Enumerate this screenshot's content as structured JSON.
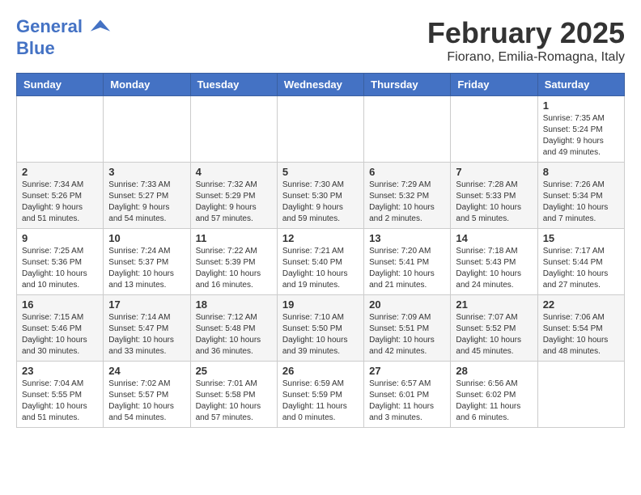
{
  "logo": {
    "line1": "General",
    "line2": "Blue"
  },
  "title": "February 2025",
  "location": "Fiorano, Emilia-Romagna, Italy",
  "weekdays": [
    "Sunday",
    "Monday",
    "Tuesday",
    "Wednesday",
    "Thursday",
    "Friday",
    "Saturday"
  ],
  "weeks": [
    [
      {
        "day": "",
        "info": ""
      },
      {
        "day": "",
        "info": ""
      },
      {
        "day": "",
        "info": ""
      },
      {
        "day": "",
        "info": ""
      },
      {
        "day": "",
        "info": ""
      },
      {
        "day": "",
        "info": ""
      },
      {
        "day": "1",
        "info": "Sunrise: 7:35 AM\nSunset: 5:24 PM\nDaylight: 9 hours\nand 49 minutes."
      }
    ],
    [
      {
        "day": "2",
        "info": "Sunrise: 7:34 AM\nSunset: 5:26 PM\nDaylight: 9 hours\nand 51 minutes."
      },
      {
        "day": "3",
        "info": "Sunrise: 7:33 AM\nSunset: 5:27 PM\nDaylight: 9 hours\nand 54 minutes."
      },
      {
        "day": "4",
        "info": "Sunrise: 7:32 AM\nSunset: 5:29 PM\nDaylight: 9 hours\nand 57 minutes."
      },
      {
        "day": "5",
        "info": "Sunrise: 7:30 AM\nSunset: 5:30 PM\nDaylight: 9 hours\nand 59 minutes."
      },
      {
        "day": "6",
        "info": "Sunrise: 7:29 AM\nSunset: 5:32 PM\nDaylight: 10 hours\nand 2 minutes."
      },
      {
        "day": "7",
        "info": "Sunrise: 7:28 AM\nSunset: 5:33 PM\nDaylight: 10 hours\nand 5 minutes."
      },
      {
        "day": "8",
        "info": "Sunrise: 7:26 AM\nSunset: 5:34 PM\nDaylight: 10 hours\nand 7 minutes."
      }
    ],
    [
      {
        "day": "9",
        "info": "Sunrise: 7:25 AM\nSunset: 5:36 PM\nDaylight: 10 hours\nand 10 minutes."
      },
      {
        "day": "10",
        "info": "Sunrise: 7:24 AM\nSunset: 5:37 PM\nDaylight: 10 hours\nand 13 minutes."
      },
      {
        "day": "11",
        "info": "Sunrise: 7:22 AM\nSunset: 5:39 PM\nDaylight: 10 hours\nand 16 minutes."
      },
      {
        "day": "12",
        "info": "Sunrise: 7:21 AM\nSunset: 5:40 PM\nDaylight: 10 hours\nand 19 minutes."
      },
      {
        "day": "13",
        "info": "Sunrise: 7:20 AM\nSunset: 5:41 PM\nDaylight: 10 hours\nand 21 minutes."
      },
      {
        "day": "14",
        "info": "Sunrise: 7:18 AM\nSunset: 5:43 PM\nDaylight: 10 hours\nand 24 minutes."
      },
      {
        "day": "15",
        "info": "Sunrise: 7:17 AM\nSunset: 5:44 PM\nDaylight: 10 hours\nand 27 minutes."
      }
    ],
    [
      {
        "day": "16",
        "info": "Sunrise: 7:15 AM\nSunset: 5:46 PM\nDaylight: 10 hours\nand 30 minutes."
      },
      {
        "day": "17",
        "info": "Sunrise: 7:14 AM\nSunset: 5:47 PM\nDaylight: 10 hours\nand 33 minutes."
      },
      {
        "day": "18",
        "info": "Sunrise: 7:12 AM\nSunset: 5:48 PM\nDaylight: 10 hours\nand 36 minutes."
      },
      {
        "day": "19",
        "info": "Sunrise: 7:10 AM\nSunset: 5:50 PM\nDaylight: 10 hours\nand 39 minutes."
      },
      {
        "day": "20",
        "info": "Sunrise: 7:09 AM\nSunset: 5:51 PM\nDaylight: 10 hours\nand 42 minutes."
      },
      {
        "day": "21",
        "info": "Sunrise: 7:07 AM\nSunset: 5:52 PM\nDaylight: 10 hours\nand 45 minutes."
      },
      {
        "day": "22",
        "info": "Sunrise: 7:06 AM\nSunset: 5:54 PM\nDaylight: 10 hours\nand 48 minutes."
      }
    ],
    [
      {
        "day": "23",
        "info": "Sunrise: 7:04 AM\nSunset: 5:55 PM\nDaylight: 10 hours\nand 51 minutes."
      },
      {
        "day": "24",
        "info": "Sunrise: 7:02 AM\nSunset: 5:57 PM\nDaylight: 10 hours\nand 54 minutes."
      },
      {
        "day": "25",
        "info": "Sunrise: 7:01 AM\nSunset: 5:58 PM\nDaylight: 10 hours\nand 57 minutes."
      },
      {
        "day": "26",
        "info": "Sunrise: 6:59 AM\nSunset: 5:59 PM\nDaylight: 11 hours\nand 0 minutes."
      },
      {
        "day": "27",
        "info": "Sunrise: 6:57 AM\nSunset: 6:01 PM\nDaylight: 11 hours\nand 3 minutes."
      },
      {
        "day": "28",
        "info": "Sunrise: 6:56 AM\nSunset: 6:02 PM\nDaylight: 11 hours\nand 6 minutes."
      },
      {
        "day": "",
        "info": ""
      }
    ]
  ]
}
